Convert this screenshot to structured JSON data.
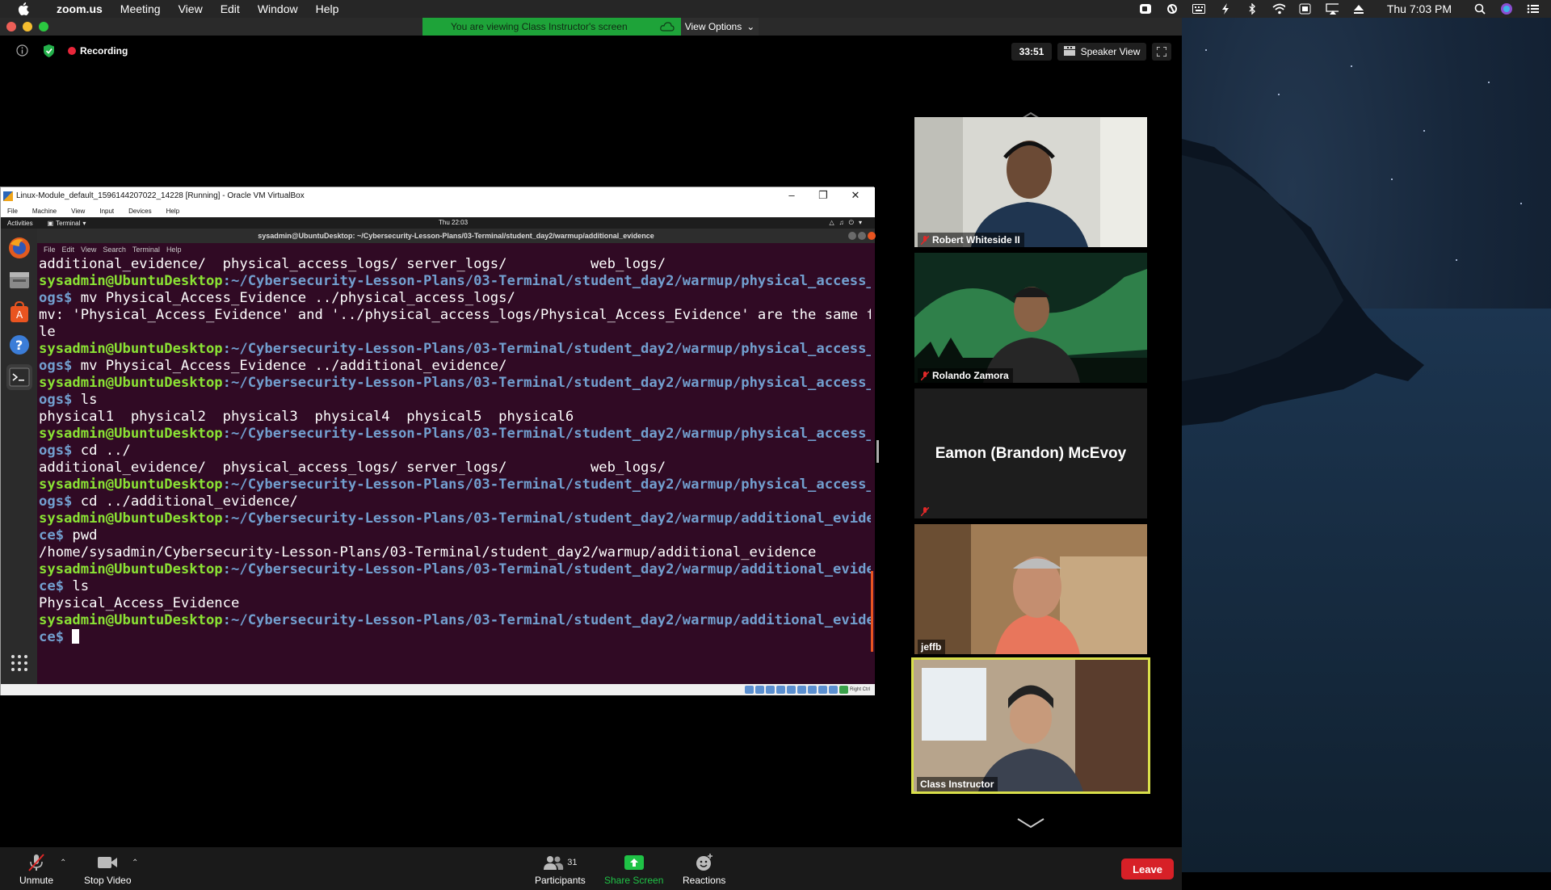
{
  "menubar": {
    "app": "zoom.us",
    "items": [
      "Meeting",
      "View",
      "Edit",
      "Window",
      "Help"
    ],
    "clock": "Thu 7:03 PM"
  },
  "zoom": {
    "banner": "You are viewing Class Instructor's screen",
    "view_options": "View Options",
    "recording": "Recording",
    "timer": "33:51",
    "speaker_view": "Speaker View",
    "colors": {
      "banner": "#1ea339",
      "recording": "#e8263a",
      "leave": "#d72027",
      "share": "#1fc246",
      "active_border": "#d9df4a"
    }
  },
  "vbox": {
    "title": "Linux-Module_default_1596144207022_14228 [Running] - Oracle VM VirtualBox",
    "menu": [
      "File",
      "Machine",
      "View",
      "Input",
      "Devices",
      "Help"
    ],
    "status_right": "Right Ctrl"
  },
  "guest": {
    "activities": "Activities",
    "terminal_app": "Terminal",
    "clock": "Thu 22:03",
    "window_title": "sysadmin@UbuntuDesktop: ~/Cybersecurity-Lesson-Plans/03-Terminal/student_day2/warmup/additional_evidence",
    "term_menu": [
      "File",
      "Edit",
      "View",
      "Search",
      "Terminal",
      "Help"
    ],
    "lines": [
      {
        "t": "out",
        "text": "additional_evidence/  physical_access_logs/ server_logs/          web_logs/"
      },
      {
        "t": "prompt",
        "user": "sysadmin@UbuntuDesktop",
        "path": ":~/Cybersecurity-Lesson-Plans/03-Terminal/student_day2/warmup/physical_access_l"
      },
      {
        "t": "cont",
        "text": "ogs$ mv Physical_Access_Evidence ../physical_access_logs/"
      },
      {
        "t": "out",
        "text": "mv: 'Physical_Access_Evidence' and '../physical_access_logs/Physical_Access_Evidence' are the same fi"
      },
      {
        "t": "out",
        "text": "le"
      },
      {
        "t": "prompt",
        "user": "sysadmin@UbuntuDesktop",
        "path": ":~/Cybersecurity-Lesson-Plans/03-Terminal/student_day2/warmup/physical_access_l"
      },
      {
        "t": "cont",
        "text": "ogs$ mv Physical_Access_Evidence ../additional_evidence/"
      },
      {
        "t": "prompt",
        "user": "sysadmin@UbuntuDesktop",
        "path": ":~/Cybersecurity-Lesson-Plans/03-Terminal/student_day2/warmup/physical_access_l"
      },
      {
        "t": "cont",
        "text": "ogs$ ls"
      },
      {
        "t": "out",
        "text": "physical1  physical2  physical3  physical4  physical5  physical6"
      },
      {
        "t": "prompt",
        "user": "sysadmin@UbuntuDesktop",
        "path": ":~/Cybersecurity-Lesson-Plans/03-Terminal/student_day2/warmup/physical_access_l"
      },
      {
        "t": "cont",
        "text": "ogs$ cd ../"
      },
      {
        "t": "out",
        "text": "additional_evidence/  physical_access_logs/ server_logs/          web_logs/"
      },
      {
        "t": "prompt",
        "user": "sysadmin@UbuntuDesktop",
        "path": ":~/Cybersecurity-Lesson-Plans/03-Terminal/student_day2/warmup/physical_access_l"
      },
      {
        "t": "cont",
        "text": "ogs$ cd ../additional_evidence/"
      },
      {
        "t": "prompt",
        "user": "sysadmin@UbuntuDesktop",
        "path": ":~/Cybersecurity-Lesson-Plans/03-Terminal/student_day2/warmup/additional_eviden"
      },
      {
        "t": "cont",
        "text": "ce$ pwd"
      },
      {
        "t": "out",
        "text": "/home/sysadmin/Cybersecurity-Lesson-Plans/03-Terminal/student_day2/warmup/additional_evidence"
      },
      {
        "t": "prompt",
        "user": "sysadmin@UbuntuDesktop",
        "path": ":~/Cybersecurity-Lesson-Plans/03-Terminal/student_day2/warmup/additional_eviden"
      },
      {
        "t": "cont",
        "text": "ce$ ls"
      },
      {
        "t": "out",
        "text": "Physical_Access_Evidence"
      },
      {
        "t": "prompt",
        "user": "sysadmin@UbuntuDesktop",
        "path": ":~/Cybersecurity-Lesson-Plans/03-Terminal/student_day2/warmup/additional_eviden"
      },
      {
        "t": "cursor",
        "text": "ce$ "
      }
    ]
  },
  "gallery": {
    "tiles": [
      {
        "name": "Robert Whiteside II",
        "muted": true,
        "video": true
      },
      {
        "name": "Rolando Zamora",
        "muted": true,
        "video": true
      },
      {
        "name": "Eamon (Brandon) McEvoy",
        "muted": true,
        "video": false
      },
      {
        "name": "jeffb",
        "muted": false,
        "video": true
      },
      {
        "name": "Class Instructor",
        "muted": false,
        "video": true,
        "active": true
      }
    ]
  },
  "toolbar": {
    "unmute": "Unmute",
    "stop_video": "Stop Video",
    "participants": "Participants",
    "participants_count": "31",
    "share_screen": "Share Screen",
    "reactions": "Reactions",
    "leave": "Leave"
  }
}
